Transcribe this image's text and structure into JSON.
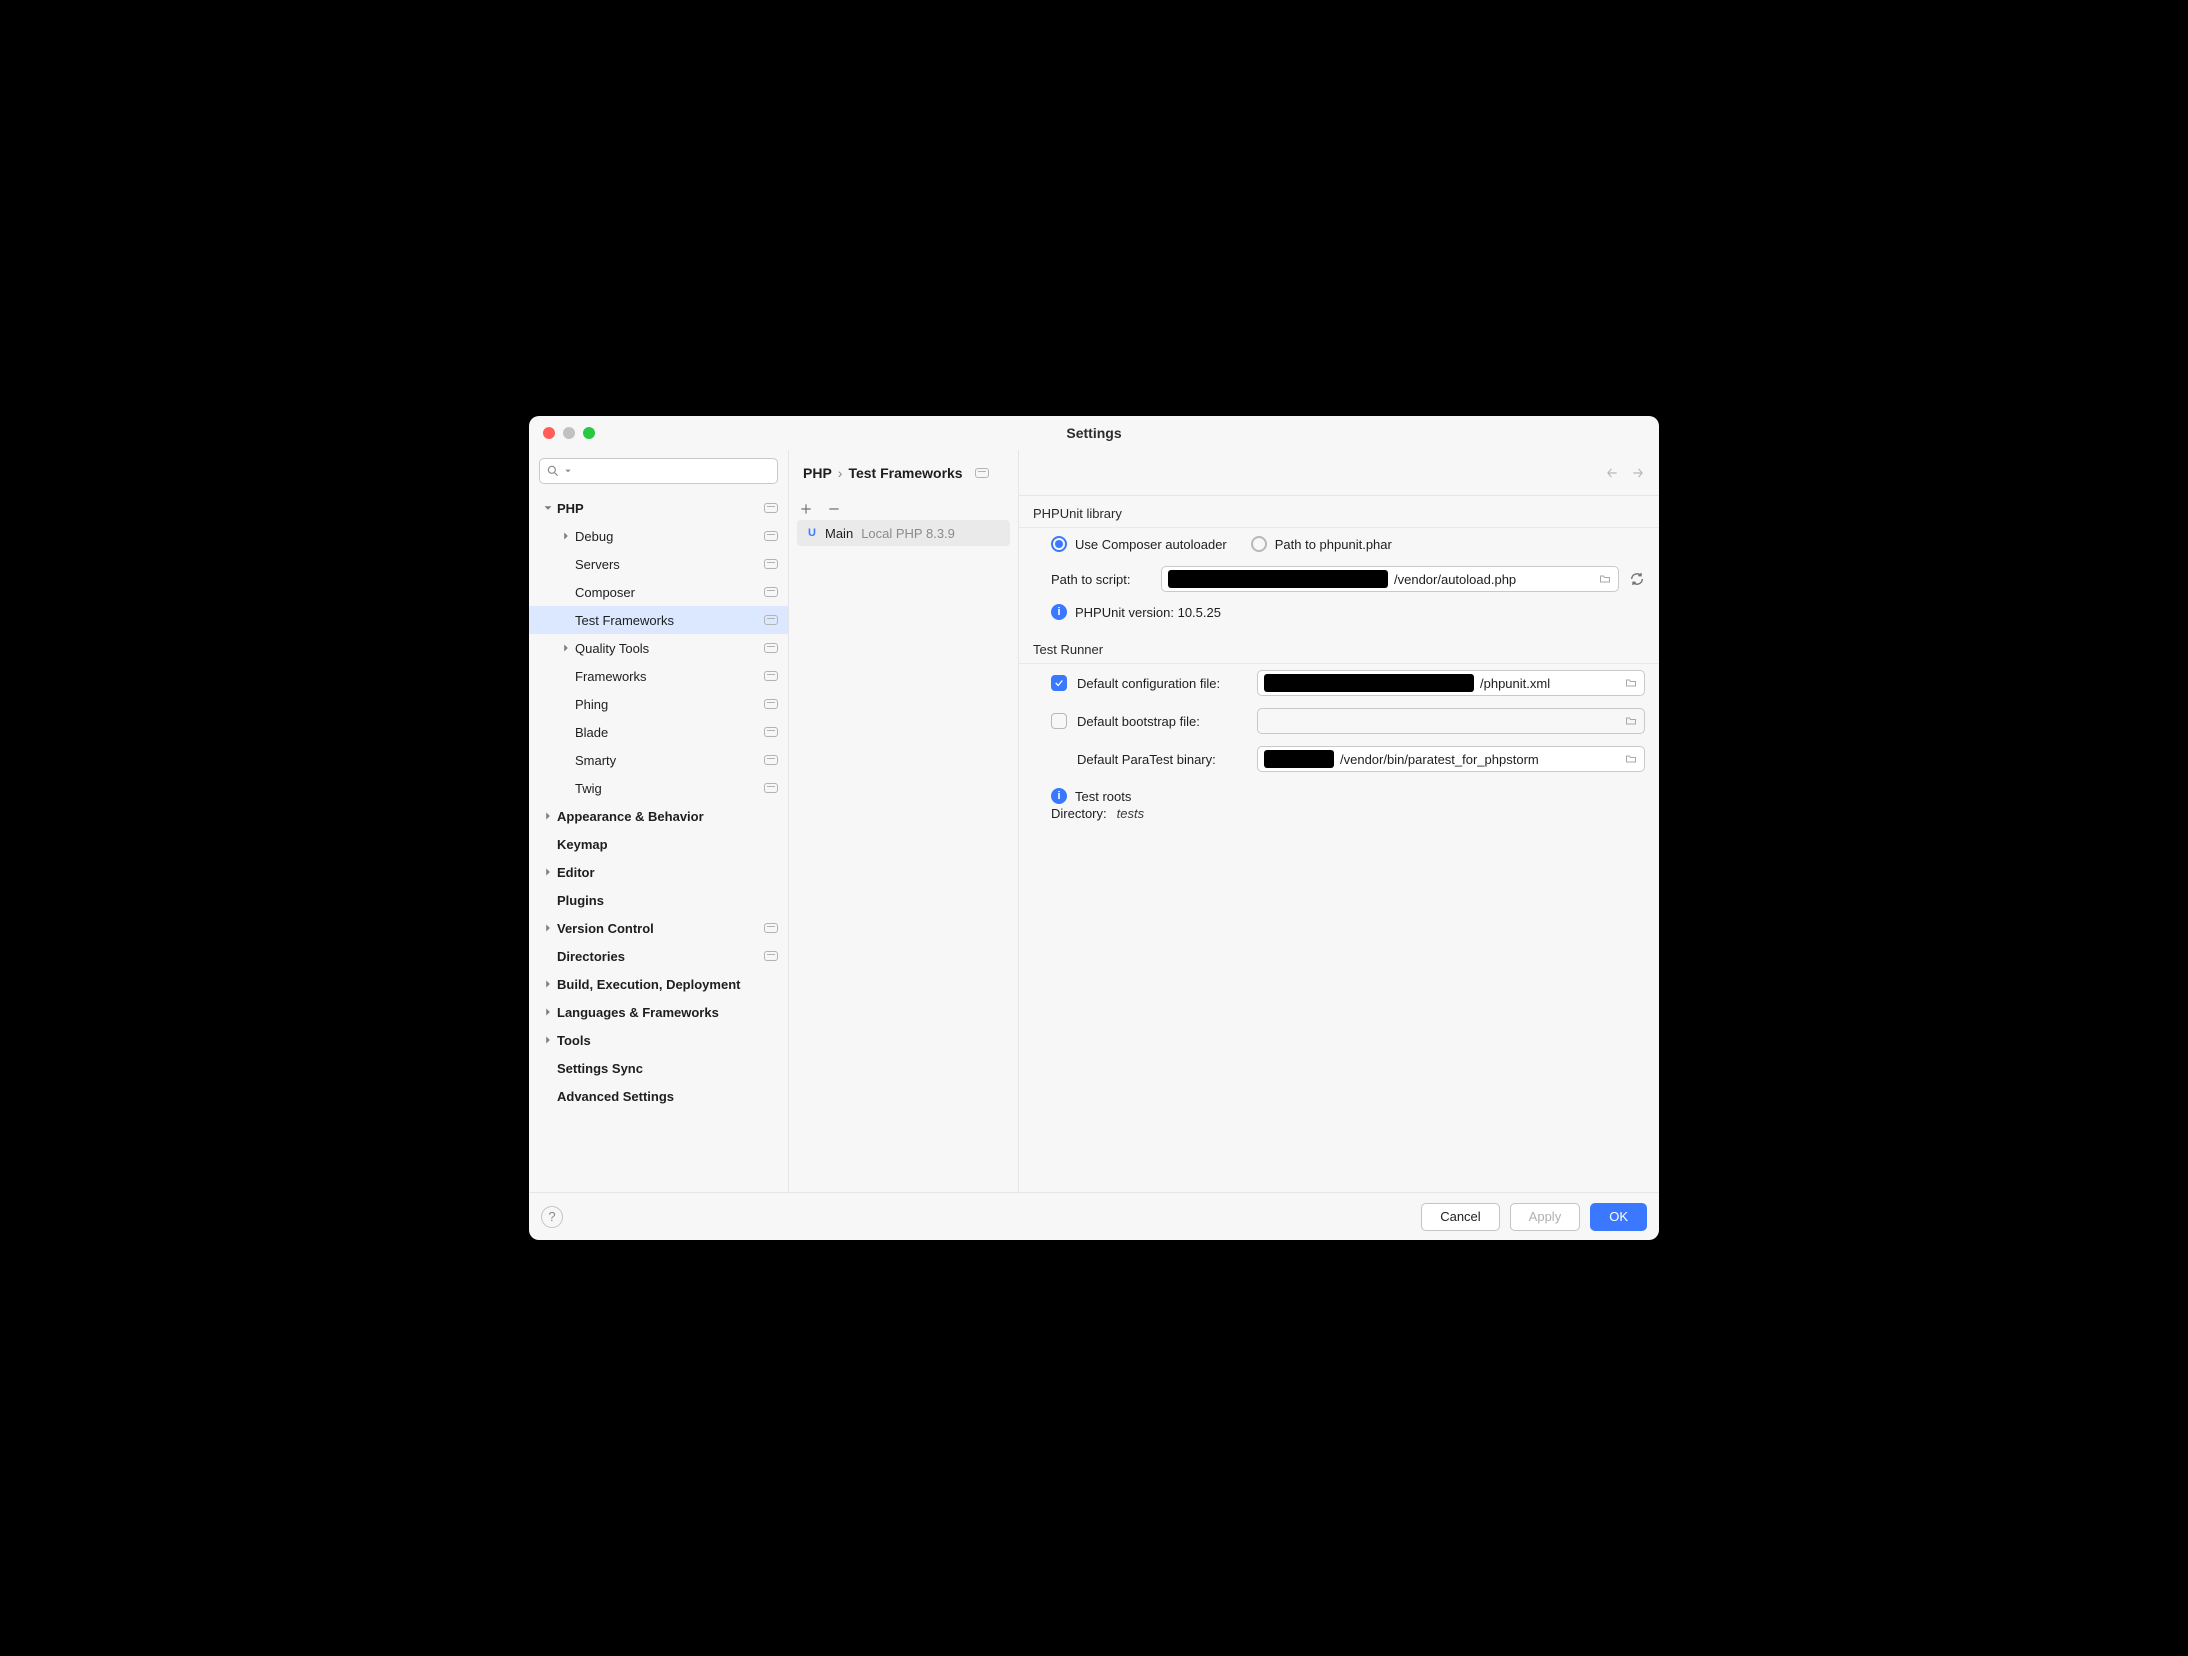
{
  "window": {
    "title": "Settings"
  },
  "sidebar": {
    "search_placeholder": "",
    "items": [
      {
        "label": "PHP",
        "indent": 0,
        "chevron": "down",
        "bold": true,
        "badge": true
      },
      {
        "label": "Debug",
        "indent": 1,
        "chevron": "right",
        "badge": true
      },
      {
        "label": "Servers",
        "indent": 1,
        "badge": true
      },
      {
        "label": "Composer",
        "indent": 1,
        "badge": true
      },
      {
        "label": "Test Frameworks",
        "indent": 1,
        "badge": true,
        "selected": true
      },
      {
        "label": "Quality Tools",
        "indent": 1,
        "chevron": "right",
        "badge": true
      },
      {
        "label": "Frameworks",
        "indent": 1,
        "badge": true
      },
      {
        "label": "Phing",
        "indent": 1,
        "badge": true
      },
      {
        "label": "Blade",
        "indent": 1,
        "badge": true
      },
      {
        "label": "Smarty",
        "indent": 1,
        "badge": true
      },
      {
        "label": "Twig",
        "indent": 1,
        "badge": true
      },
      {
        "label": "Appearance & Behavior",
        "indent": 0,
        "chevron": "right",
        "bold": true
      },
      {
        "label": "Keymap",
        "indent": 0,
        "bold": true
      },
      {
        "label": "Editor",
        "indent": 0,
        "chevron": "right",
        "bold": true
      },
      {
        "label": "Plugins",
        "indent": 0,
        "bold": true
      },
      {
        "label": "Version Control",
        "indent": 0,
        "chevron": "right",
        "bold": true,
        "badge": true
      },
      {
        "label": "Directories",
        "indent": 0,
        "bold": true,
        "badge": true
      },
      {
        "label": "Build, Execution, Deployment",
        "indent": 0,
        "chevron": "right",
        "bold": true
      },
      {
        "label": "Languages & Frameworks",
        "indent": 0,
        "chevron": "right",
        "bold": true
      },
      {
        "label": "Tools",
        "indent": 0,
        "chevron": "right",
        "bold": true
      },
      {
        "label": "Settings Sync",
        "indent": 0,
        "bold": true
      },
      {
        "label": "Advanced Settings",
        "indent": 0,
        "bold": true
      }
    ]
  },
  "breadcrumb": {
    "root": "PHP",
    "sep": "›",
    "leaf": "Test Frameworks"
  },
  "mid": {
    "items": [
      {
        "name": "Main",
        "detail": "Local PHP 8.3.9"
      }
    ]
  },
  "phpunit": {
    "section": "PHPUnit library",
    "radio_composer": "Use Composer autoloader",
    "radio_phar": "Path to phpunit.phar",
    "path_label": "Path to script:",
    "path_suffix": "/vendor/autoload.php",
    "version_label": "PHPUnit version: 10.5.25"
  },
  "runner": {
    "section": "Test Runner",
    "cfg_label": "Default configuration file:",
    "cfg_suffix": "/phpunit.xml",
    "bootstrap_label": "Default bootstrap file:",
    "paratest_label": "Default ParaTest binary:",
    "paratest_suffix": "/vendor/bin/paratest_for_phpstorm",
    "roots_label": "Test roots",
    "roots_dir_label": "Directory: ",
    "roots_dir_value": "tests"
  },
  "footer": {
    "cancel": "Cancel",
    "apply": "Apply",
    "ok": "OK"
  }
}
